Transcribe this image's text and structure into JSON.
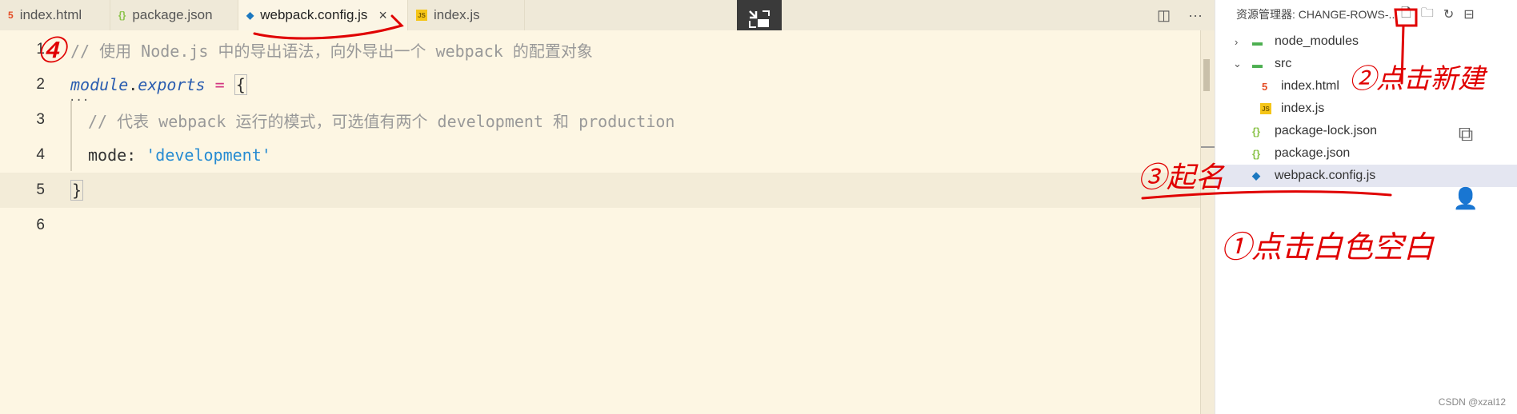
{
  "tabs": [
    {
      "icon": "html-file-icon",
      "label": "index.html",
      "active": false
    },
    {
      "icon": "json-file-icon",
      "label": "package.json",
      "active": false
    },
    {
      "icon": "webpack-file-icon",
      "label": "webpack.config.js",
      "active": true,
      "close": "×"
    },
    {
      "icon": "js-file-icon",
      "label": "index.js",
      "active": false
    }
  ],
  "tab_actions": {
    "split": "◫",
    "more": "···"
  },
  "editor": {
    "lines": [
      {
        "num": "1",
        "comment": "// 使用 Node.js 中的导出语法，向外导出一个 webpack 的配置对象"
      },
      {
        "num": "2",
        "module": "module",
        "dot": ".",
        "exports": "exports",
        "eq": " = ",
        "brace": "{"
      },
      {
        "num": "3",
        "comment": "// 代表 webpack 运行的模式，可选值有两个 development 和 production"
      },
      {
        "num": "4",
        "key": "mode: ",
        "str": "'development'"
      },
      {
        "num": "5",
        "brace": "}"
      },
      {
        "num": "6"
      }
    ],
    "fold_marker": "···"
  },
  "sidebar": {
    "title": "资源管理器: CHANGE-ROWS-...",
    "items": [
      {
        "label": "node_modules",
        "kind": "folder",
        "chev": "›"
      },
      {
        "label": "src",
        "kind": "folder-open",
        "chev": "⌄"
      },
      {
        "label": "index.html",
        "kind": "html"
      },
      {
        "label": "index.js",
        "kind": "js"
      },
      {
        "label": "package-lock.json",
        "kind": "json"
      },
      {
        "label": "package.json",
        "kind": "json"
      },
      {
        "label": "webpack.config.js",
        "kind": "webpack",
        "selected": true
      }
    ]
  },
  "annotations": {
    "a4": "④",
    "a2": "②点击新建",
    "a3": "③起名",
    "a1": "①点击白色空白"
  },
  "watermark": "CSDN @xzal12",
  "colors": {
    "editor_bg": "#fdf6e3",
    "annotation": "#e00000",
    "selected_bg": "#e4e6f1"
  }
}
